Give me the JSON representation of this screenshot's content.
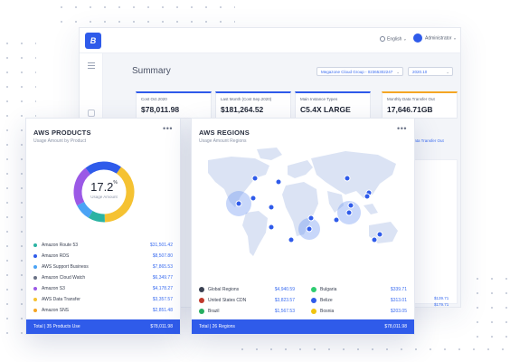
{
  "app": {
    "logo_text": "B",
    "language": "English",
    "user": "Administrator",
    "page_title": "Summary",
    "account_select": "Megazone Cloud Group - 02365302247",
    "month_select": "2020.10"
  },
  "kpis": [
    {
      "label": "Cost Oct.2020",
      "value": "$78,011.98",
      "sub": ""
    },
    {
      "label": "Last Month (Cost Sep.2020)",
      "value": "$181,264.52",
      "sub": ""
    },
    {
      "label": "Main Instance Types",
      "value": "C5.4X LARGE",
      "sub": ""
    },
    {
      "label": "Monthly Data Transfer Out",
      "value": "17,646.71GB",
      "sub": "Data Transfer Out"
    }
  ],
  "background_values": [
    "$139.71",
    "$179.71"
  ],
  "products": {
    "title": "AWS PRODUCTS",
    "subtitle": "Usage Amount by Product",
    "center_value": "17.2",
    "center_unit": "%",
    "center_label": "Usage Amount",
    "items": [
      {
        "name": "Amazon Route 53",
        "amount": "$31,501.42",
        "color": "#2bb3a3"
      },
      {
        "name": "Amazon RDS",
        "amount": "$8,507.80",
        "color": "#2f5bea"
      },
      {
        "name": "AWS Support Business",
        "amount": "$7,865.53",
        "color": "#4ba3f5"
      },
      {
        "name": "Amazon Cloud Watch",
        "amount": "$6,349.77",
        "color": "#6a7286"
      },
      {
        "name": "Amazon S3",
        "amount": "$4,178.27",
        "color": "#9b59e6"
      },
      {
        "name": "AWS Data Transfer",
        "amount": "$3,357.57",
        "color": "#f5c232"
      },
      {
        "name": "Amazon SNS",
        "amount": "$2,851.48",
        "color": "#f5a623"
      }
    ],
    "footer_left": "Total  |  35 Products Use",
    "footer_right": "$78,011.98"
  },
  "regions": {
    "title": "AWS REGIONS",
    "subtitle": "Usage Amount Regions",
    "items_left": [
      {
        "name": "Global Regions",
        "amount": "$4,940.59",
        "color": "#3a4152"
      },
      {
        "name": "United States CDN",
        "amount": "$3,823.57",
        "color": "#c0392b"
      },
      {
        "name": "Brazil",
        "amount": "$1,567.53",
        "color": "#27ae60"
      }
    ],
    "items_right": [
      {
        "name": "Bulgaria",
        "amount": "$339.71",
        "color": "#2ecc71"
      },
      {
        "name": "Belize",
        "amount": "$313.01",
        "color": "#2f5bea"
      },
      {
        "name": "Bosnia",
        "amount": "$203.05",
        "color": "#f1c40f"
      }
    ],
    "footer_left": "Total  |  26 Regions",
    "footer_right": "$78,011.98"
  },
  "donut_segments": [
    {
      "value": 40,
      "color": "#f5c232"
    },
    {
      "value": 9,
      "color": "#2bb3a3"
    },
    {
      "value": 9,
      "color": "#4ba3f5"
    },
    {
      "value": 22,
      "color": "#9b59e6"
    },
    {
      "value": 20,
      "color": "#2f5bea"
    }
  ],
  "colors": {
    "accent": "#2f5bea",
    "map": "#d9e2f5",
    "bubble": "rgba(96,140,240,0.35)",
    "dot": "#2f5bea"
  }
}
